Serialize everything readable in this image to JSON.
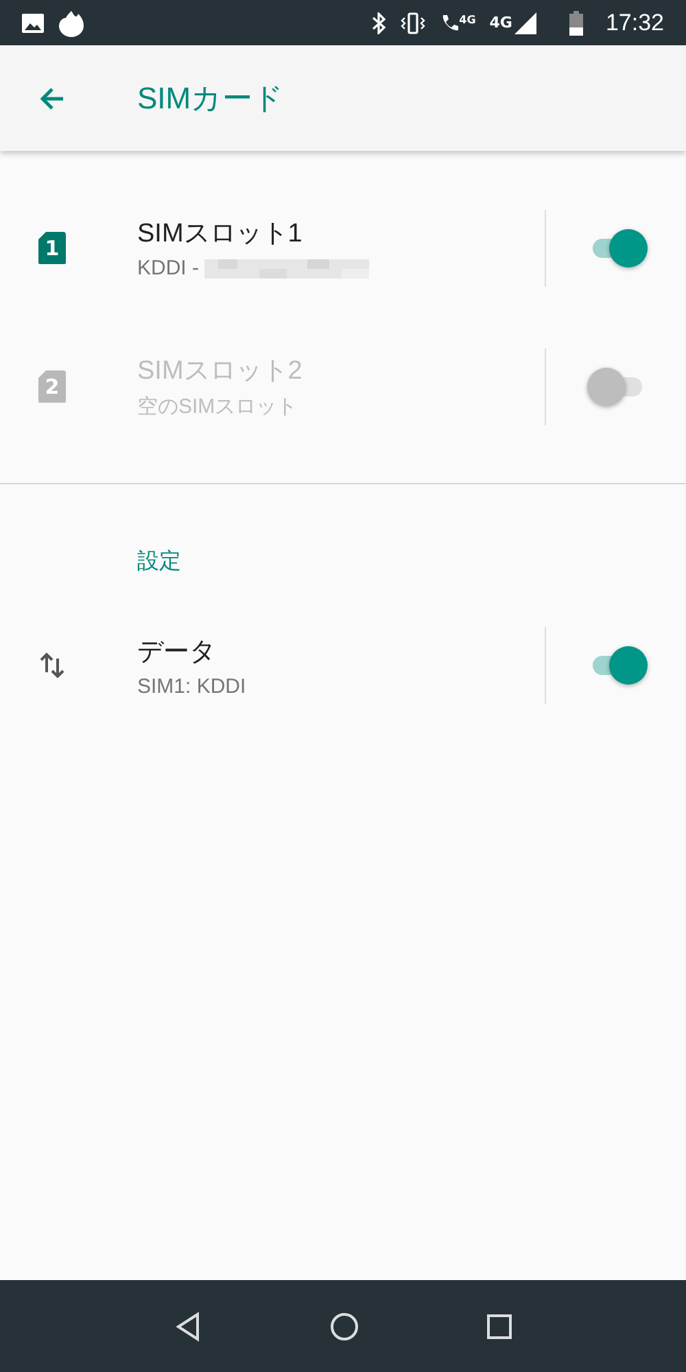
{
  "status_bar": {
    "network_labels": [
      "4G",
      "4G"
    ],
    "time": "17:32"
  },
  "app_bar": {
    "title": "SIMカード"
  },
  "sim_slots": [
    {
      "badge": "1",
      "title": "SIMスロット1",
      "subtitle": "KDDI - ",
      "redacted": true,
      "disabled": false,
      "on": true
    },
    {
      "badge": "2",
      "title": "SIMスロット2",
      "subtitle": "空のSIMスロット",
      "redacted": false,
      "disabled": true,
      "on": false
    }
  ],
  "section": {
    "title": "設定"
  },
  "settings": [
    {
      "title": "データ",
      "subtitle": "SIM1: KDDI",
      "on": true
    }
  ]
}
